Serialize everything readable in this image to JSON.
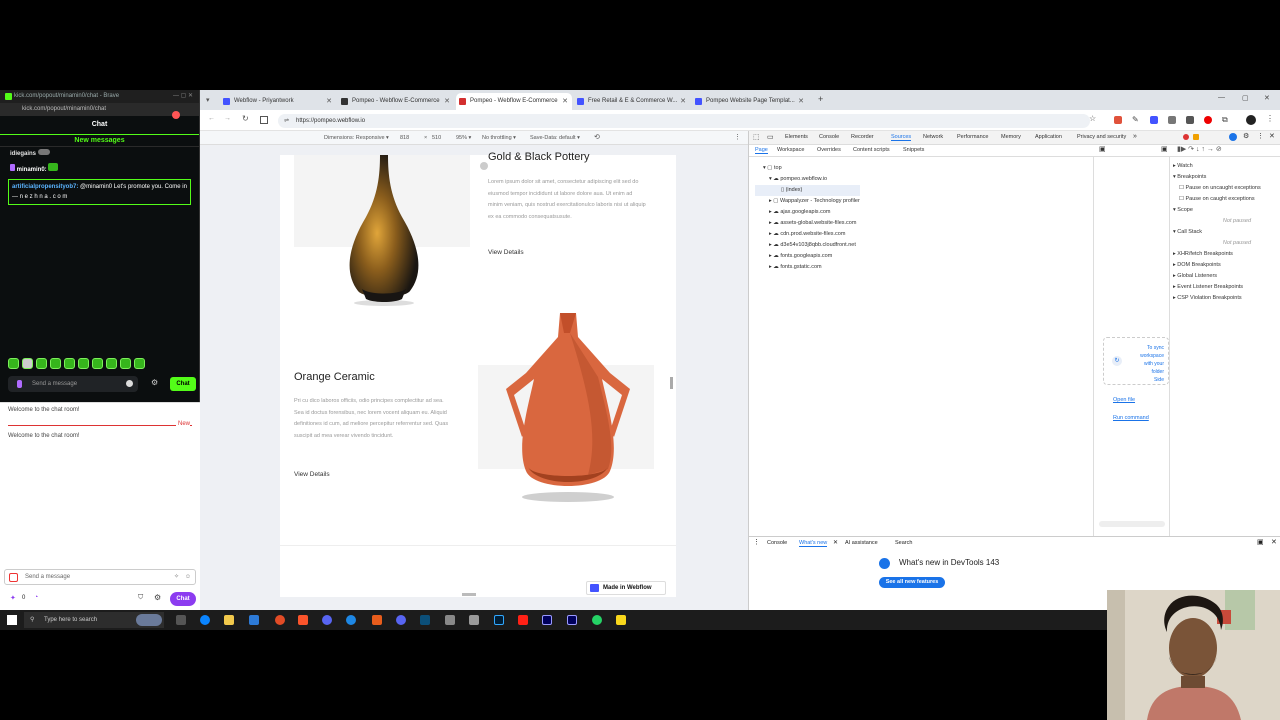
{
  "kick": {
    "window_title": "kick.com/popout/minamin0/chat - Brave",
    "url": "kick.com/popout/minamin0/chat",
    "chat_title": "Chat",
    "new_messages": "New messages",
    "messages": [
      {
        "user": "idiegains",
        "text": ""
      },
      {
        "user": "minamin0:",
        "text": ""
      }
    ],
    "highlight": {
      "user": "artificialpropensityob7:",
      "text": "@minamin0 Let's promote you. Come in — n e z h n a . c o m"
    },
    "send_placeholder": "Send a message",
    "chat_button": "Chat"
  },
  "chat2": {
    "welcome_1": "Welcome to the chat room!",
    "welcome_2": "Welcome to the chat room!",
    "new_label": "New",
    "send_placeholder": "Send a message",
    "count": "0",
    "chat_button": "Chat"
  },
  "browser": {
    "tabs": [
      {
        "label": "Webflow - Priyantwork",
        "color": "#4353ff"
      },
      {
        "label": "Pompeo - Webflow E-Commerce",
        "color": "#333333"
      },
      {
        "label": "Pompeo - Webflow E-Commerce",
        "color": "#d32f2f"
      },
      {
        "label": "Free Retail & E & Commerce W...",
        "color": "#4353ff"
      },
      {
        "label": "Pompeo Website Page Templat...",
        "color": "#4353ff"
      }
    ],
    "url": "https://pompeo.webflow.io",
    "device_bar": {
      "dimensions": "Dimensions: Responsive ▾",
      "width": "818",
      "x": "×",
      "height": "510",
      "zoom": "95% ▾",
      "throttle": "No throttling ▾",
      "save_data": "Save-Data: default ▾"
    }
  },
  "page": {
    "product1": {
      "title": "Gold & Black Pottery",
      "desc": "Lorem ipsum dolor sit amet, consectetur adipiscing elit sed do eiusmod tempor incididunt ut labore dolore aua. Ut enim ad minim veniam, quis nostrud exercitationulco laboris nisi ut aliquip ex ea commodo consequatsusute.",
      "link": "View Details"
    },
    "product2": {
      "title": "Orange Ceramic",
      "desc": "Pri cu dico laboros officiis, odio principes complectitur ad sea. Sea id doctus forensibus, nec lorem vocent aliquam eu. Aliquid definitiones id cum, ad meliore percepitur referrentur sed. Quas suscipit ad mea verear vivendo tincidunt.",
      "link": "View Details"
    },
    "made_in": "Made in Webflow"
  },
  "devtools": {
    "tabs": [
      "Elements",
      "Console",
      "Recorder",
      "Sources",
      "Network",
      "Performance",
      "Memory",
      "Application",
      "Privacy and security"
    ],
    "active_tab": "Sources",
    "subtabs": [
      "Page",
      "Workspace",
      "Overrides",
      "Content scripts",
      "Snippets"
    ],
    "tree": [
      "top",
      "pompeo.webflow.io",
      "(index)",
      "Wappalyzer - Technology profiler",
      "ajax.googleapis.com",
      "assets-global.website-files.com",
      "cdn.prod.website-files.com",
      "d3e54v103j8qbb.cloudfront.net",
      "fonts.googleapis.com",
      "fonts.gstatic.com"
    ],
    "right_pane": [
      "Watch",
      "Breakpoints",
      "Pause on uncaught exceptions",
      "Pause on caught exceptions",
      "Scope",
      "Not paused",
      "Call Stack",
      "Not paused",
      "XHR/fetch Breakpoints",
      "DOM Breakpoints",
      "Global Listeners",
      "Event Listener Breakpoints",
      "CSP Violation Breakpoints"
    ],
    "sync_text": [
      "To sync",
      "workspace",
      "with your",
      "folder",
      "Side"
    ],
    "open_file": "Open file",
    "run_command": "Run command",
    "drawer_tabs": [
      "Console",
      "What's new",
      "AI assistance",
      "Search"
    ],
    "whats_new": "What's new in DevTools 143",
    "see_all": "See all new features"
  },
  "taskbar": {
    "search": "Type here to search"
  }
}
